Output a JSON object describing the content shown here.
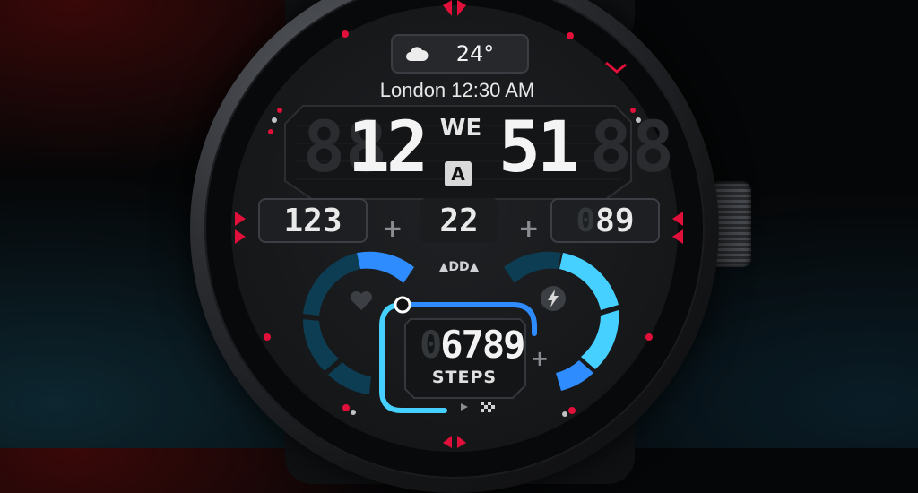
{
  "weather": {
    "temperature": "24°",
    "icon": "cloud-icon"
  },
  "clock": {
    "city_time": "London 12:30 AM",
    "hours": "12",
    "minutes": "51",
    "day": "WE",
    "ampm": "A",
    "ghost_left": "88",
    "ghost_right": "88"
  },
  "complications": {
    "left_value": "123",
    "center_value": "22",
    "right_value": "89",
    "right_ghost": "0"
  },
  "steps": {
    "value": "6789",
    "label": "STEPS",
    "ghost": "0"
  },
  "brand_mark": "DD",
  "gauges": {
    "heart_icon": "heart-icon",
    "battery_icon": "lightning-icon"
  },
  "colors": {
    "accent_blue": "#2f8cff",
    "accent_cyan": "#46d0ff",
    "marker_red": "#e0103a"
  }
}
